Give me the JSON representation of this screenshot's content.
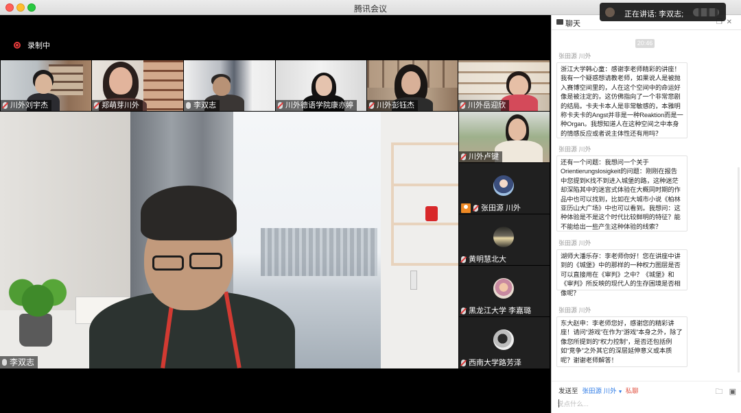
{
  "window": {
    "title": "腾讯会议"
  },
  "speaking": {
    "label": "正在讲话: 李双志;"
  },
  "recording": {
    "label": "录制中"
  },
  "thumbnails": [
    {
      "name": "川外刘宇杰"
    },
    {
      "name": "郑萌芽川外"
    },
    {
      "name": "李双志"
    },
    {
      "name": "川外德语学院康亦婷"
    },
    {
      "name": "川外彭钰杰"
    },
    {
      "name": "川外岳迎欣"
    }
  ],
  "main_speaker": {
    "name": "李双志"
  },
  "side_tiles": [
    {
      "name": "川外卢键"
    },
    {
      "name": "张田源 川外"
    },
    {
      "name": "黄明慧北大"
    },
    {
      "name": "黑龙江大学 李嘉璐"
    },
    {
      "name": "西南大学路芳泽"
    }
  ],
  "chat": {
    "title": "聊天",
    "time": "20:46",
    "messages": [
      {
        "sender": "张田源 川外",
        "text": "浙江大学韩心童：感谢李老师精彩的讲座！我有一个疑惑想请教老师，如果说人是被抛入赛博空间里的，人在这个空间中的命运好像是被注定的，这仿佛指向了一个非常悲剧的结局。卡夫卡本人是非常敏感的，本雅明称卡夫卡的Angst并非是一种Reaktion而是一种Organ。我想知道人在这种空间之中本身的情感反应或者说主体性还有用吗？"
      },
      {
        "sender": "张田源 川外",
        "text": "还有一个问题：我想问一个关于Orientierungslosigkeit的问题：刚刚在报告中您提到K找不到进入城堡的路，这种迷茫却深陷其中的迷宫式体验在大概同时期的作品中也可以找到，比如在大城市小说《柏林亚历山大广场》中也可以看到。我想问：这种体验是不是这个时代比较鲜明的特征？能不能给出一些产生这种体验的线索？"
      },
      {
        "sender": "张田源 川外",
        "text": "湖师大潘乐存：李老师你好！您在讲座中讲到的《城堡》中的那样的一种权力图层是否可以直接用在《审判》之中？《城堡》和《审判》所反映的现代人的生存困境是否相像呢？"
      },
      {
        "sender": "张田源 川外",
        "text": "东大赵申：李老师您好，感谢您的精彩讲座！请问“游戏”在作为“游戏”本身之外，除了像您所提到的“权力控制”，是否还包括例如“竞争”之外其它的深层延伸意义或本质呢？谢谢老师解答！"
      }
    ],
    "send_to_label": "发送至",
    "send_to_name": "张田源 川外",
    "private_label": "私聊",
    "input_placeholder": "说点什么..."
  }
}
